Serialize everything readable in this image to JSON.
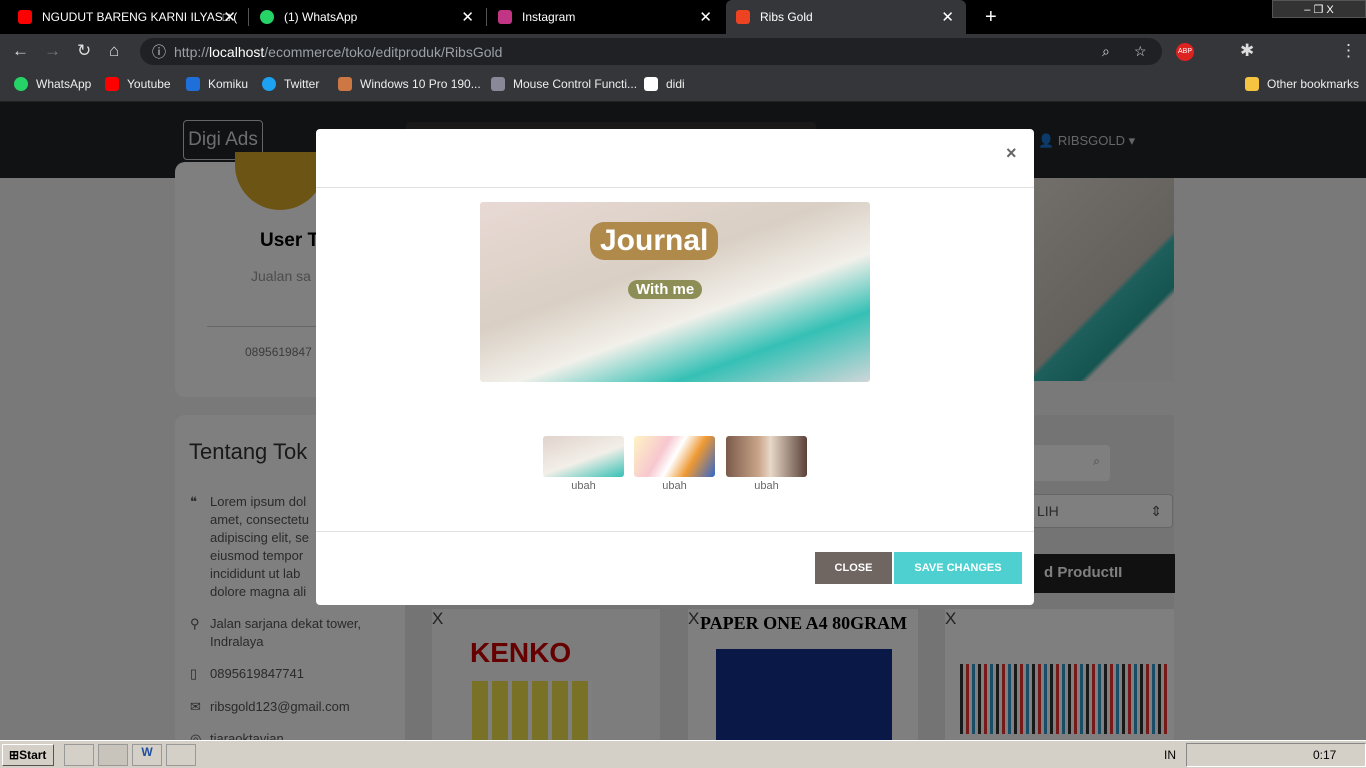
{
  "browser": {
    "tabs": [
      {
        "title": "NGUDUT BARENG KARNI ILYAS□ (",
        "icon": "youtube-icon",
        "color": "#ff0000"
      },
      {
        "title": "(1) WhatsApp",
        "icon": "whatsapp-icon",
        "color": "#25d366"
      },
      {
        "title": "Instagram",
        "icon": "instagram-icon",
        "color": "#c13584"
      },
      {
        "title": "Ribs Gold",
        "icon": "codeigniter-icon",
        "color": "#ee4323"
      }
    ],
    "new_tab": "+",
    "url_prefix": "http://",
    "url_host": "localhost",
    "url_path": "/ecommerce/toko/editproduk/RibsGold",
    "bookmarks": [
      "WhatsApp",
      "Youtube",
      "Komiku",
      "Twitter",
      "Windows 10 Pro 190...",
      "Mouse Control Functi...",
      "didi"
    ],
    "other_bookmarks": "Other bookmarks"
  },
  "site": {
    "brand": "Digi Ads",
    "user": "RIBSGOLD",
    "profile": {
      "name": "User T",
      "tagline": "Jualan sa",
      "phone_short": "0895619847"
    },
    "about": {
      "title": "Tentang Tok",
      "text": "Lorem ipsum dol amet, consectetu adipiscing elit, se eiusmod tempor incididunt ut lab dolore magna ali",
      "address": "Jalan sarjana dekat tower, Indralaya",
      "phone": "0895619847741",
      "email": "ribsgold123@gmail.com",
      "instagram": "tiaraoktavian"
    },
    "select_value": "LIH",
    "add_button": "d ProductII",
    "products": [
      {
        "title": "KENKO",
        "remove": "X"
      },
      {
        "title": "PAPER ONE A4 80GRAM",
        "remove": "X"
      },
      {
        "title": "",
        "remove": "X"
      }
    ]
  },
  "modal": {
    "close_x": "×",
    "thumb_labels": [
      "ubah",
      "ubah",
      "ubah"
    ],
    "close": "CLOSE",
    "save": "SAVE CHANGES",
    "image_text": "Journal",
    "image_subtext": "With me"
  },
  "taskbar": {
    "start": "Start",
    "lang": "IN",
    "time": "0:17"
  }
}
